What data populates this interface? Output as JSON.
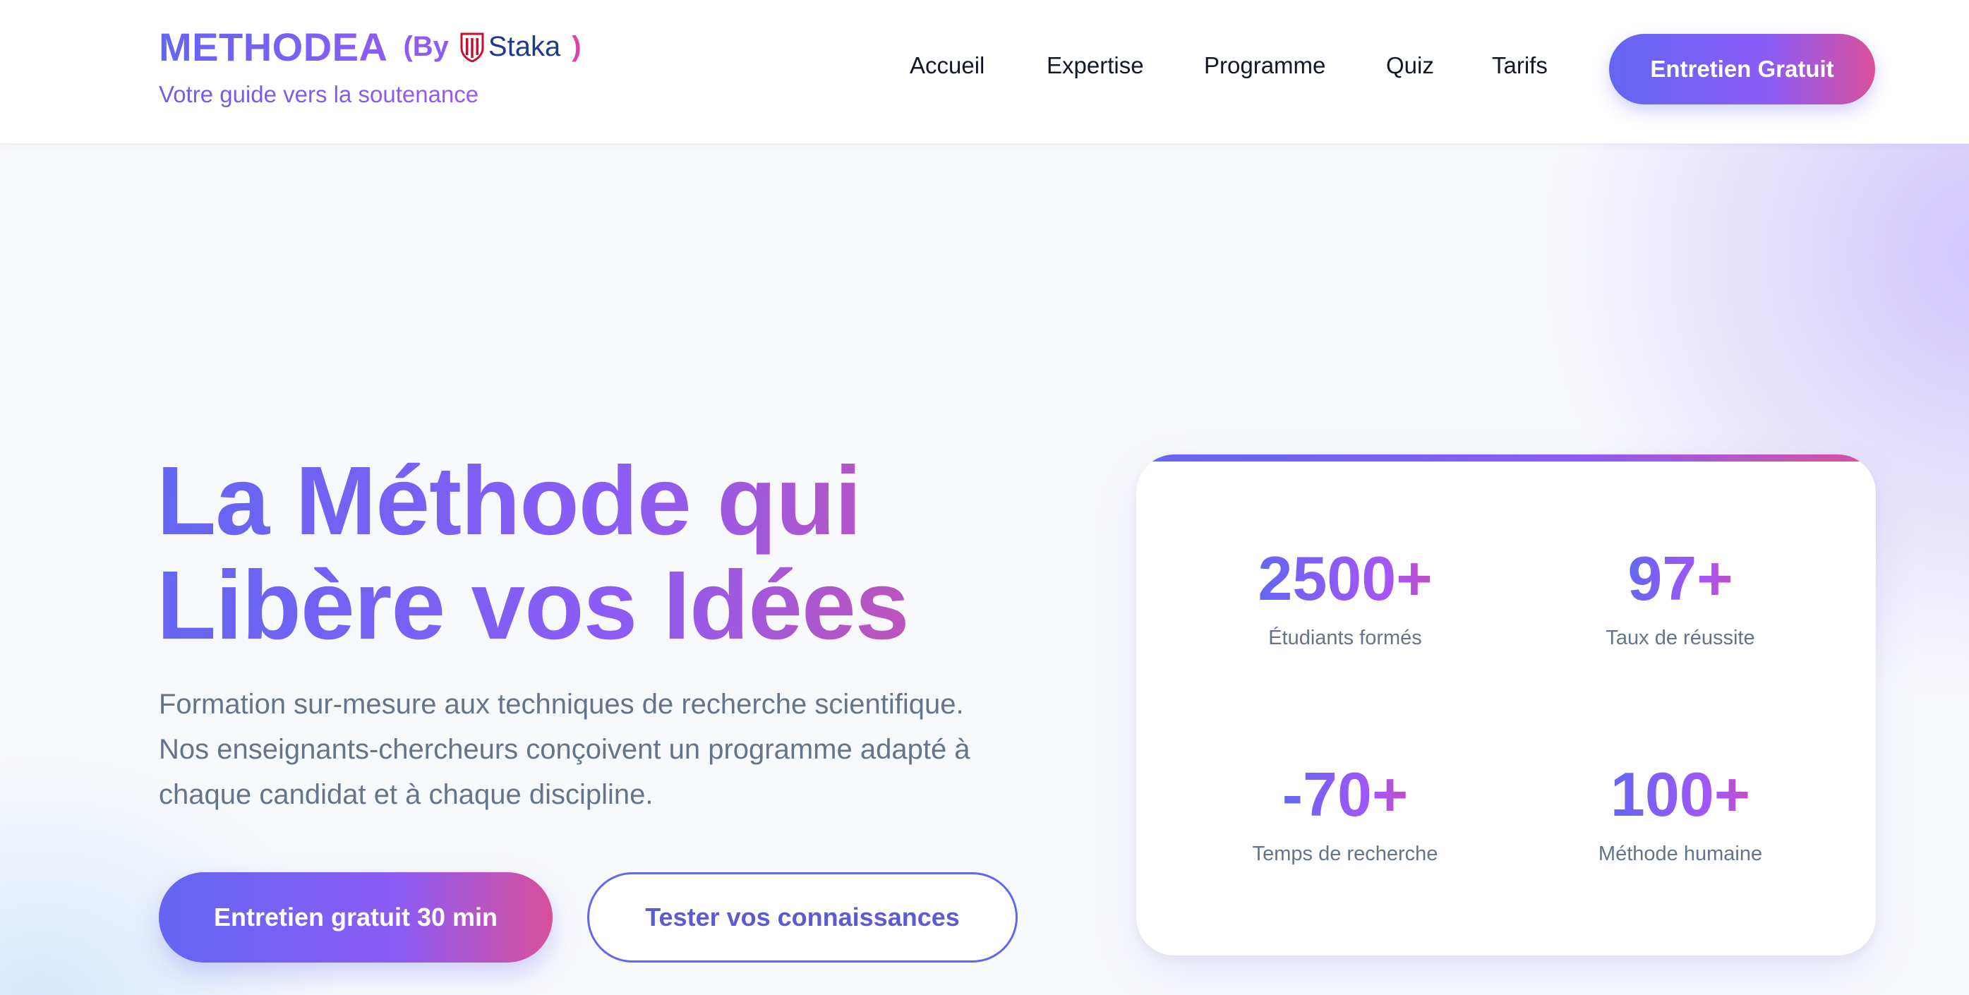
{
  "header": {
    "brand_name": "METHODEA",
    "brand_by": "(By",
    "partner_logo": "Staka",
    "brand_close": ")",
    "tagline": "Votre guide vers la soutenance",
    "nav": [
      "Accueil",
      "Expertise",
      "Programme",
      "Quiz",
      "Tarifs"
    ],
    "cta": "Entretien Gratuit"
  },
  "hero": {
    "title_line1": "La Méthode qui",
    "title_line2": "Libère vos Idées",
    "subtitle_line1": "Formation sur-mesure aux techniques de recherche scientifique.",
    "subtitle_line2": "Nos enseignants-chercheurs conçoivent un programme adapté à",
    "subtitle_line3": "chaque candidat et à chaque discipline.",
    "primary_button": "Entretien gratuit 30 min",
    "secondary_button": "Tester vos connaissances"
  },
  "stats": [
    {
      "value": "2500+",
      "label": "Étudiants formés"
    },
    {
      "value": "97+",
      "label": "Taux de réussite"
    },
    {
      "value": "-70+",
      "label": "Temps de recherche"
    },
    {
      "value": "100+",
      "label": "Méthode humaine"
    }
  ],
  "colors": {
    "gradient_start": "#6366f1",
    "gradient_mid": "#8b5cf6",
    "gradient_end": "#d9509c",
    "body_text": "#64748b",
    "nav_text": "#111827",
    "staka_blue": "#1e3a8a",
    "staka_red": "#c8102e"
  }
}
